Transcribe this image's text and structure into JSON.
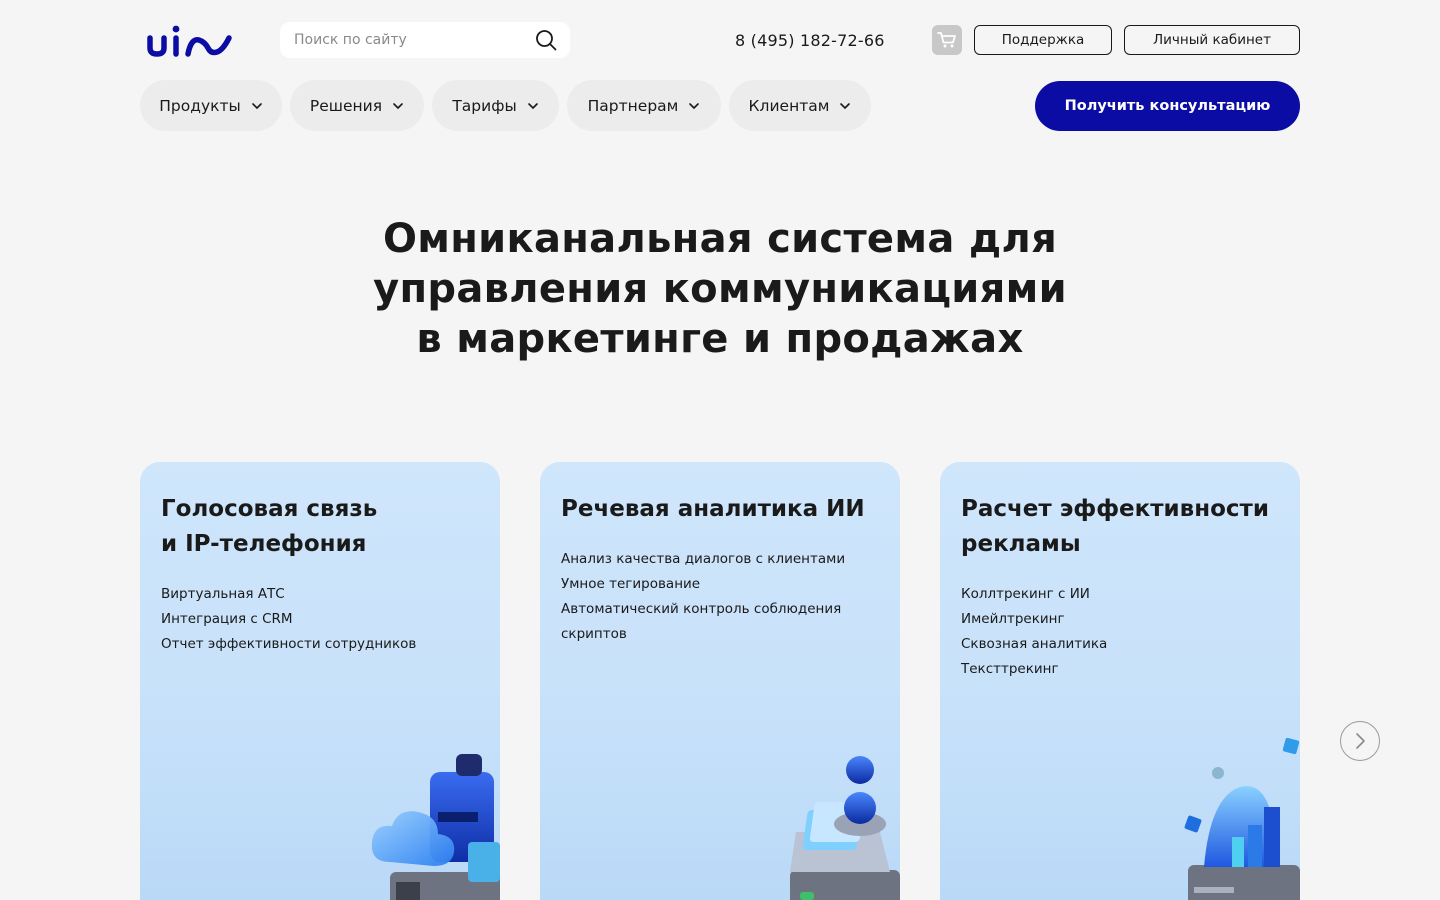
{
  "header": {
    "search_placeholder": "Поиск по сайту",
    "phone": "8 (495) 182-72-66",
    "support_label": "Поддержка",
    "cabinet_label": "Личный кабинет",
    "cta_label": "Получить консультацию",
    "icons": {
      "logo": "uis-logo",
      "search": "search-icon",
      "cart": "cart-icon"
    }
  },
  "nav": {
    "items": [
      {
        "label": "Продукты"
      },
      {
        "label": "Решения"
      },
      {
        "label": "Тарифы"
      },
      {
        "label": "Партнерам"
      },
      {
        "label": "Клиентам"
      }
    ]
  },
  "hero": {
    "line1": "Омниканальная система для",
    "line2": "управления коммуникациями",
    "line3": "в маркетинге и продажах"
  },
  "cards": [
    {
      "title_line1": "Голосовая связь",
      "title_line2": "и IP-телефония",
      "items": [
        "Виртуальная АТС",
        "Интеграция с CRM",
        "Отчет эффективности сотрудников"
      ]
    },
    {
      "title_line1": "Речевая аналитика ИИ",
      "title_line2": "",
      "items": [
        "Анализ качества диалогов с клиентами",
        "Умное тегирование",
        "Автоматический контроль соблюдения скриптов"
      ]
    },
    {
      "title_line1": "Расчет эффективности",
      "title_line2": "рекламы",
      "items": [
        "Коллтрекинг с ИИ",
        "Имейлтрекинг",
        "Сквозная аналитика",
        "Тексттрекинг"
      ]
    }
  ],
  "colors": {
    "brand": "#0b0ca3",
    "card_bg": "#cfe6fb",
    "page_bg": "#f5f5f5",
    "text": "#1a1a1a"
  }
}
